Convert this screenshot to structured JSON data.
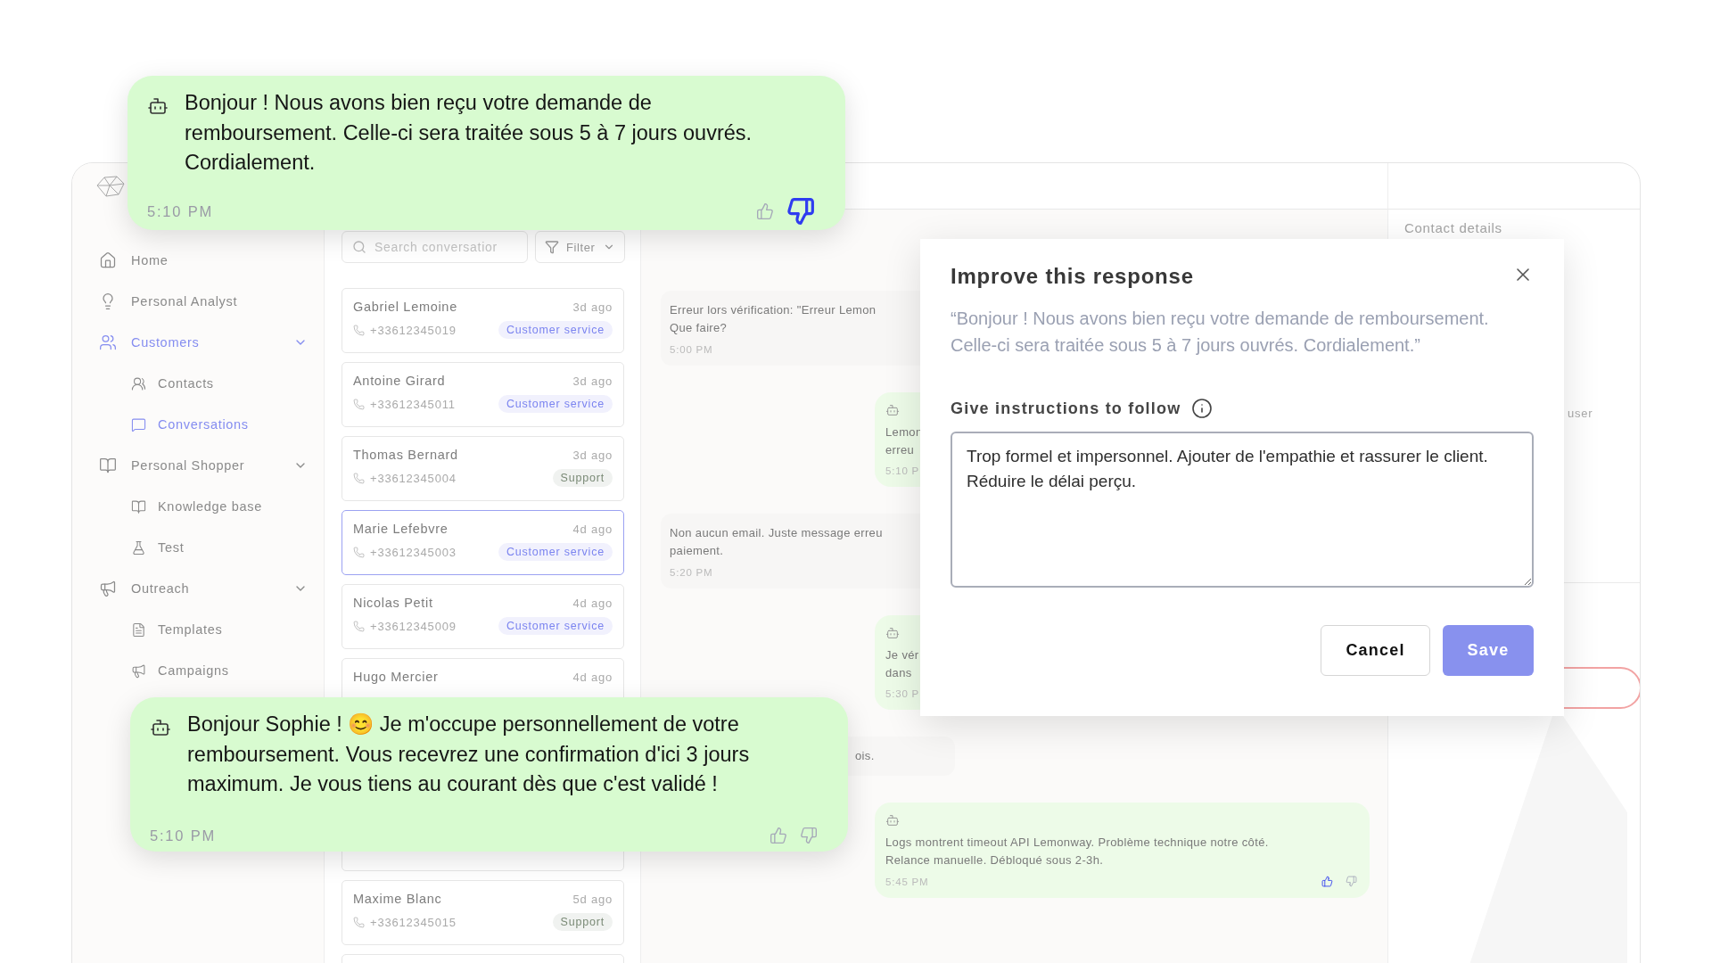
{
  "sidebar": {
    "items": [
      {
        "label": "Home",
        "selected": false
      },
      {
        "label": "Personal Analyst",
        "selected": false
      },
      {
        "label": "Customers",
        "selected": true,
        "expanded": true,
        "children": [
          {
            "label": "Contacts",
            "selected": false
          },
          {
            "label": "Conversations",
            "selected": true
          }
        ]
      },
      {
        "label": "Personal Shopper",
        "selected": false,
        "expanded": true,
        "children": [
          {
            "label": "Knowledge base",
            "selected": false
          },
          {
            "label": "Test",
            "selected": false
          }
        ]
      },
      {
        "label": "Outreach",
        "selected": false,
        "expanded": true,
        "children": [
          {
            "label": "Templates",
            "selected": false
          },
          {
            "label": "Campaigns",
            "selected": false
          }
        ]
      }
    ]
  },
  "conversation_list": {
    "search": {
      "placeholder": "Search conversatior"
    },
    "filter": "Filter",
    "items": [
      {
        "name": "Gabriel Lemoine",
        "time": "3d ago",
        "phone": "+33612345019",
        "tag": "Customer service",
        "color": "#7b84f0",
        "selected": false
      },
      {
        "name": "Antoine Girard",
        "time": "3d ago",
        "phone": "+33612345011",
        "tag": "Customer service",
        "color": "#7b84f0",
        "selected": false
      },
      {
        "name": "Thomas Bernard",
        "time": "3d ago",
        "phone": "+33612345004",
        "tag": "Support",
        "color": "#7a8a76",
        "selected": false
      },
      {
        "name": "Marie Lefebvre",
        "time": "4d ago",
        "phone": "+33612345003",
        "tag": "Customer service",
        "color": "#7b84f0",
        "selected": true
      },
      {
        "name": "Nicolas Petit",
        "time": "4d ago",
        "phone": "+33612345009",
        "tag": "Customer service",
        "color": "#7b84f0",
        "selected": false
      },
      {
        "name": "Hugo Mercier",
        "time": "4d ago",
        "selected": false
      },
      {
        "name": "Maxime Blanc",
        "time": "5d ago",
        "phone": "+33612345015",
        "tag": "Support",
        "color": "#7a8a76",
        "selected": false
      }
    ]
  },
  "chat": {
    "messages": [
      {
        "kind": "user",
        "text": "Erreur lors vérification: \"Erreur Lemon\nQue faire?",
        "time": "5:00 PM"
      },
      {
        "kind": "bot",
        "text": "Lemon\nerreu",
        "time": "5:10 P"
      },
      {
        "kind": "user",
        "text": "Non aucun email. Juste message erreu\npaiement.",
        "time": "5:20 PM"
      },
      {
        "kind": "bot",
        "text": "Je vér\ndans",
        "time": "5:30 P"
      },
      {
        "kind": "user",
        "text": "ois."
      },
      {
        "kind": "bot",
        "text": "Logs montrent timeout API Lemonway. Problème technique notre côté.\nRelance manuelle. Débloqué sous 2-3h.",
        "time": "5:45 PM",
        "liked": true,
        "disliked": false
      }
    ]
  },
  "contact_panel": {
    "title": "Contact details",
    "fragment": "user"
  },
  "highlighted_messages": [
    {
      "text": "Bonjour ! Nous avons bien reçu votre demande de remboursement. Celle-ci sera traitée sous 5 à 7 jours ouvrés. Cordialement.",
      "time": "5:10 PM",
      "liked": false,
      "disliked": true
    },
    {
      "text": "Bonjour Sophie ! 😊 Je m'occupe personnellement de votre remboursement. Vous recevrez une confirmation d'ici 3 jours maximum. Je vous tiens au courant dès que c'est validé !",
      "time": "5:10 PM",
      "liked": false,
      "disliked": false
    }
  ],
  "modal": {
    "title": "Improve this response",
    "quote": "“Bonjour ! Nous avons bien reçu votre demande de remboursement. Celle-ci sera traitée sous 5 à 7 jours ouvrés. Cordialement.”",
    "label": "Give instructions to follow",
    "value": "Trop formel et impersonnel. Ajouter de l'empathie et rassurer le client. Réduire le délai perçu.",
    "cancel": "Cancel",
    "save": "Save"
  }
}
